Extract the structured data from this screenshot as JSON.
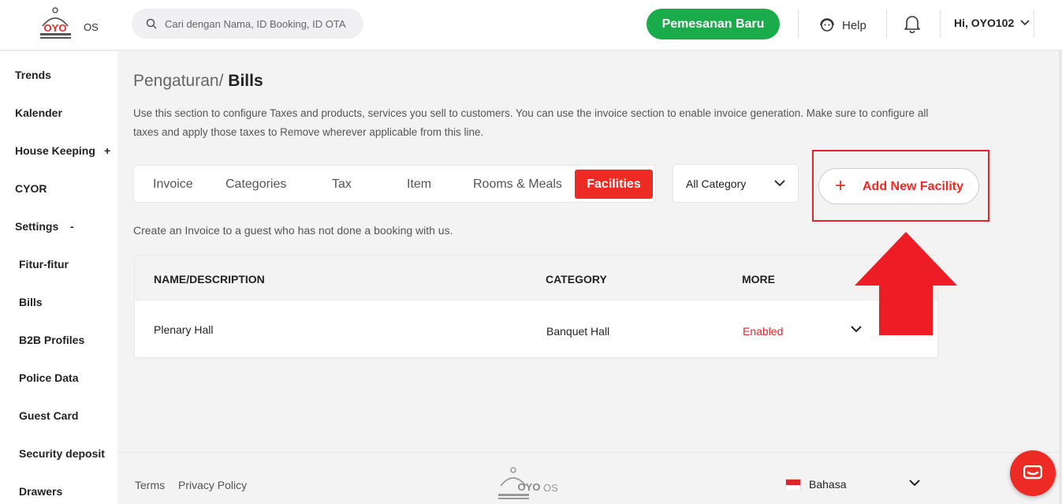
{
  "header": {
    "logo_text": "OYO",
    "logo_suffix": "OS",
    "search_placeholder": "Cari dengan Nama, ID Booking, ID OTA",
    "new_booking_label": "Pemesanan Baru",
    "help_label": "Help",
    "user_label": "Hi, OYO102"
  },
  "sidebar": {
    "items": [
      {
        "label": "Trends"
      },
      {
        "label": "Kalender"
      },
      {
        "label": "House Keeping",
        "sign": "+"
      },
      {
        "label": "CYOR"
      },
      {
        "label": "Settings",
        "sign": "-"
      }
    ],
    "sub_items": [
      {
        "label": "Fitur-fitur"
      },
      {
        "label": "Bills"
      },
      {
        "label": "B2B Profiles"
      },
      {
        "label": "Police Data"
      },
      {
        "label": "Guest Card"
      },
      {
        "label": "Security deposit"
      },
      {
        "label": "Drawers"
      }
    ]
  },
  "main": {
    "breadcrumb_parent": "Pengaturan/",
    "breadcrumb_current": "Bills",
    "description": "Use this section to configure Taxes and products, services you sell to customers. You can use the invoice section to enable invoice generation. Make sure to configure all taxes and apply those taxes to Remove wherever applicable from this line.",
    "tabs": [
      {
        "label": "Invoice"
      },
      {
        "label": "Categories"
      },
      {
        "label": "Tax"
      },
      {
        "label": "Item"
      },
      {
        "label": "Rooms & Meals"
      },
      {
        "label": "Facilities",
        "active": true
      }
    ],
    "category_select": "All Category",
    "add_button_label": "Add New Facility",
    "note": "Create an Invoice to a guest who has not done a booking with us.",
    "table": {
      "headers": [
        "NAME/DESCRIPTION",
        "CATEGORY",
        "MORE"
      ],
      "rows": [
        {
          "name": "Plenary Hall",
          "category": "Banquet Hall",
          "status": "Enabled"
        }
      ]
    }
  },
  "footer": {
    "terms": "Terms",
    "privacy": "Privacy Policy",
    "logo_text": "OYO",
    "logo_suffix": "OS",
    "language": "Bahasa"
  },
  "colors": {
    "brand_red": "#ee2a24",
    "green": "#1aab4a",
    "highlight": "#e0262b"
  }
}
